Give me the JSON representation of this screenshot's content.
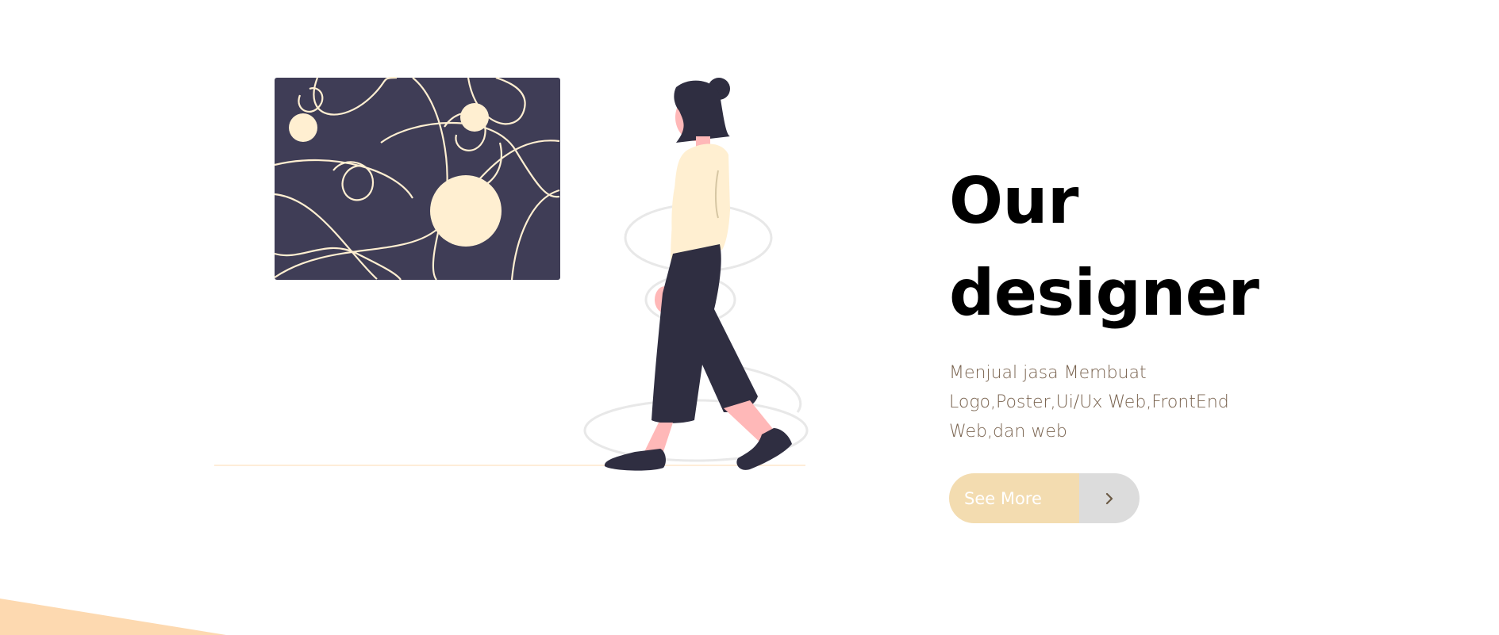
{
  "hero": {
    "title_line1": "Our",
    "title_line2": "designer",
    "description": "Menjual jasa Membuat Logo,Poster,Ui/Ux Web,FrontEnd Web,dan web",
    "cta_label": "See More",
    "cta_icon": "chevron-right-icon"
  },
  "colors": {
    "painting_bg": "#3f3d56",
    "accent_cream": "#ffefd1",
    "button_bg": "#f3dcb0",
    "button_arrow_bg": "#dcdcdc",
    "description_text": "#7a6450",
    "corner_shape": "#fdd9b0"
  }
}
